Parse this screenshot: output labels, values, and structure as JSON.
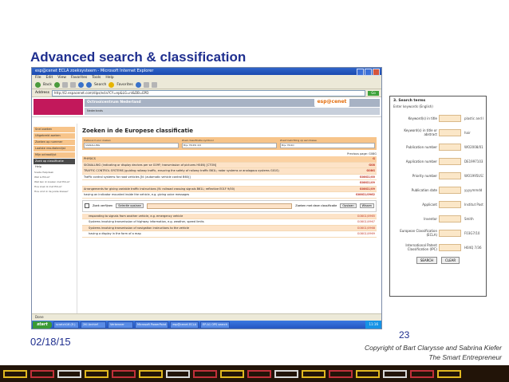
{
  "slide": {
    "title": "Advanced search  &  classification",
    "date": "02/18/15",
    "page_number": "23",
    "copyright_line1": "Copyright of Bart Clarysse and Sabrina Kiefer",
    "copyright_line2": "The Smart Entrepreneur",
    "deco_colors": [
      "#e0b820",
      "#c0303a",
      "#d8d8d8",
      "#e0b820",
      "#c0303a",
      "#e0b820",
      "#d8d8d8",
      "#c0303a",
      "#e0b820",
      "#c0303a",
      "#d8d8d8",
      "#e0b820",
      "#c0303a",
      "#e0b820",
      "#d8d8d8",
      "#c0303a",
      "#e0b820"
    ]
  },
  "browser": {
    "window_title": "esp@cenet ECLA zoeksysteem - Microsoft Internet Explorer",
    "menu": [
      "File",
      "Edit",
      "View",
      "Favorites",
      "Tools",
      "Help"
    ],
    "back_label": "Back",
    "search_label": "Search",
    "favorites_label": "Favorites",
    "address_label": "Address",
    "address_value": "http://l2.espacenet.com/dips/ecla?CY=ep&LG=nl&DB=EPD",
    "go_label": "Go",
    "site_header": "Octrooicentrum Nederland",
    "site_subheader": "Nederlands",
    "espacenet_logo": "esp@cenet",
    "sidebar_items": [
      {
        "label": "Snel zoeken",
        "style": "normal"
      },
      {
        "label": "Uitgebreid zoeken",
        "style": "normal"
      },
      {
        "label": "Zoeken op nummer",
        "style": "normal"
      },
      {
        "label": "Laatste resultatenlijst",
        "style": "normal"
      },
      {
        "label": "Mijn octrooilijst",
        "style": "normal"
      },
      {
        "label": "Zoek op classificatie",
        "style": "dark"
      },
      {
        "label": "Help",
        "style": "plain"
      }
    ],
    "sidebar_notes": [
      "Snelle Helpdesk",
      "Wat is ECLA?",
      "Wat kan ik zoeken met ECLA?",
      "Hoe zoek ik met ECLA?",
      "Hoe vind ik de juiste klasse?"
    ],
    "page_heading": "Zoeken in de Europese classificatie",
    "search_fields": [
      {
        "label": "Trefwoord voor zoeken",
        "value": "SIGNALLING"
      },
      {
        "label": "Zoek classificatie symbool",
        "value": "Bijv. H04W 4/0"
      },
      {
        "label": "Zoek toelichting op een klasse",
        "value": "Bijv. H04Q"
      }
    ],
    "previous_page": "Previous page: G08G",
    "rows": [
      {
        "text": "PHYSICS",
        "code": "G",
        "style": "orange"
      },
      {
        "text": "SIGNALLING (indicating or display devices per se G09F; transmission of pictures H04N) [CTON]",
        "code": "G08",
        "style": "tinted"
      },
      {
        "text": "TRAFFIC CONTROL SYSTEMS (guiding railway traffic, ensuring the safety of railway traffic B61L; radar systems or analogous systems G01S)",
        "code": "G08G",
        "style": "tinted"
      },
      {
        "text": "Traffic control systems for road vehicles [N: (automatic vehicle control B60)]",
        "code": "G08G1/00",
        "style": "white"
      },
      {
        "text": "",
        "code": "G08G1/09",
        "style": "white"
      },
      {
        "text": "Arrangements for giving variable traffic instructions (N: railroad crossing signals B61L; reflective E01F 9/00)",
        "code": "G08G1/09",
        "style": "tinted"
      },
      {
        "text": "having an indicator mounted inside the vehicle, e.g. giving voice messages",
        "code": "G08G1/0962",
        "style": "white"
      }
    ],
    "refine_label": "Zoek verfijnen",
    "refine_button": "Selectie opslaan",
    "refine_hint": "Zoeken met deze classificatie",
    "refine_go": "Opslaan",
    "refine_clear": "Wissen",
    "sub_rows": [
      {
        "text": "responding to signals from another vehicle, e.g. emergency vehicle",
        "code": "G08G1/0965",
        "style": "tinted"
      },
      {
        "text": "Systems involving transmission of highway information, e.g. weather, speed limits",
        "code": "G08G1/0967",
        "style": "white"
      },
      {
        "text": "Systems involving transmission of navigation instructions to the vehicle",
        "code": "G08G1/0968",
        "style": "tinted"
      },
      {
        "text": "having a display in the form of a map",
        "code": "G08G1/0969",
        "style": "white"
      }
    ],
    "status_text": "Done",
    "taskbar_start": "start",
    "taskbar_items": [
      "scratch16 (E:)",
      "2Ki Archief",
      "Verkenner",
      "Microsoft PowerPoint",
      "esp@cenet ECLA",
      "EP-A1 OPS search"
    ],
    "tray_time": "11:16"
  },
  "form": {
    "title": "3. Search terms",
    "subtitle": "Enter keywords (English)",
    "fields": [
      {
        "label": "Keyword(s) in title",
        "hint": "plastic and bicycle"
      },
      {
        "label": "Keyword(s) in title or abstract",
        "hint": "hair"
      },
      {
        "label": "Publication number",
        "hint": "WO2008/014520"
      },
      {
        "label": "Application number",
        "hint": "DE19971031743"
      },
      {
        "label": "Priority number",
        "hint": "WO1995US15925"
      },
      {
        "label": "Publication date",
        "hint": "yyyymmdd"
      },
      {
        "label": "Applicant",
        "hint": "Institut Pasteur"
      },
      {
        "label": "Inventor",
        "hint": "Smith"
      },
      {
        "label": "European Classification (ECLA)",
        "hint": "F03G7/10"
      },
      {
        "label": "International Patent Classification (IPC)",
        "hint": "H04Q 7/36"
      }
    ],
    "search_button": "SEARCH",
    "clear_button": "CLEAR"
  }
}
